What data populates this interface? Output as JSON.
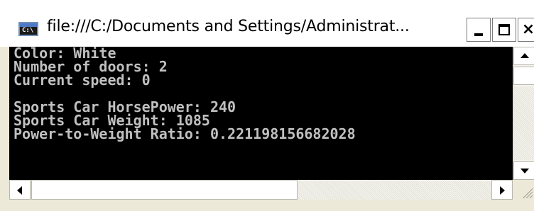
{
  "window": {
    "title": "file:///C:/Documents and Settings/Administrat...",
    "app_icon": "console-app-icon",
    "app_icon_text": "C:\\",
    "buttons": {
      "minimize": "minimize-icon",
      "maximize": "maximize-icon",
      "close": "close-icon",
      "close_glyph": "×"
    }
  },
  "console": {
    "background": "#000000",
    "foreground": "#c0c0c0",
    "lines": [
      "Color: White",
      "Number of doors: 2",
      "Current speed: 0",
      "",
      "Sports Car HorsePower: 240",
      "Sports Car Weight: 1085",
      "Power-to-Weight Ratio: 0.221198156682028"
    ]
  },
  "scrollbars": {
    "vertical": {
      "up": "scroll-up-arrow-icon",
      "down": "scroll-down-arrow-icon"
    },
    "horizontal": {
      "left": "scroll-left-arrow-icon",
      "right": "scroll-right-arrow-icon"
    }
  }
}
